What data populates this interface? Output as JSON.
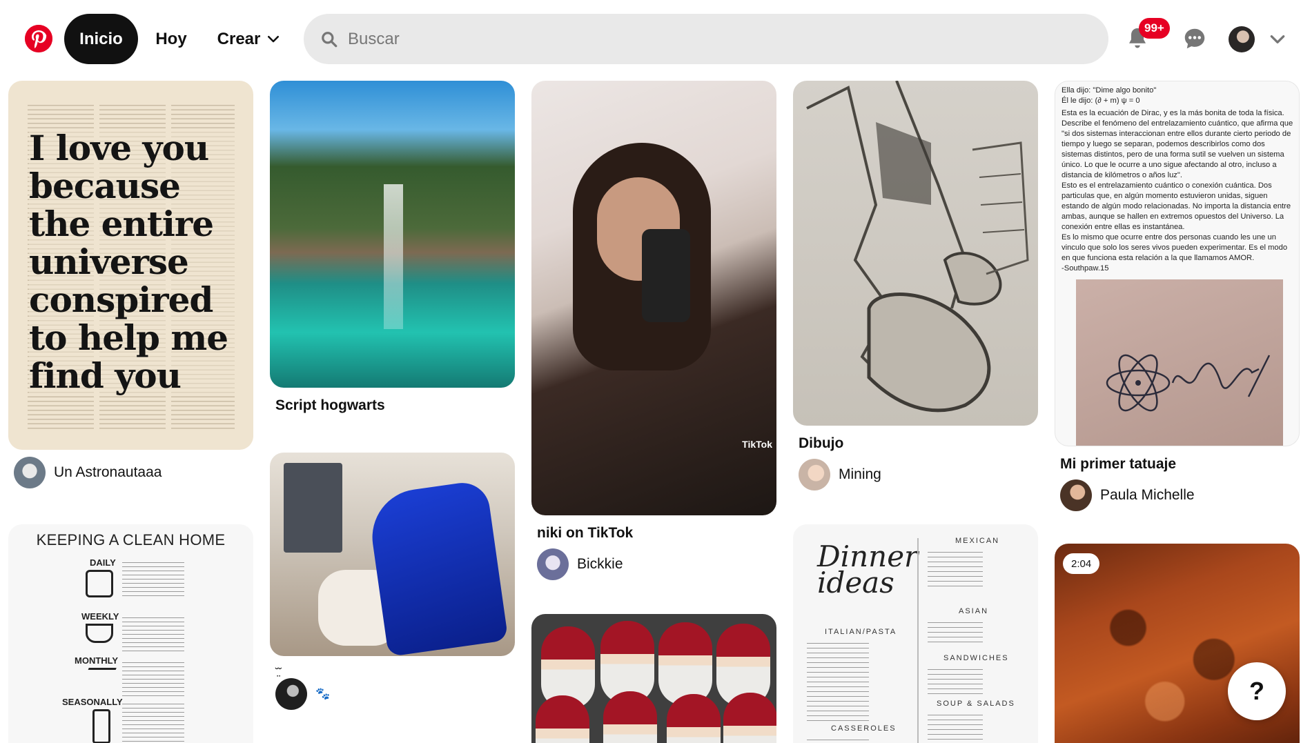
{
  "header": {
    "nav_home": "Inicio",
    "nav_today": "Hoy",
    "nav_create": "Crear",
    "search_placeholder": "Buscar",
    "notifications_badge": "99+"
  },
  "pins": {
    "quote": {
      "lines": [
        "I love you",
        "because",
        "the entire",
        "universe",
        "conspired",
        "to help me",
        "find you"
      ],
      "user": "Un Astronautaaa"
    },
    "lagoon": {
      "title": "Script hogwarts"
    },
    "blue": {
      "title": "˘̤˘",
      "user": "🐾"
    },
    "girl": {
      "title": "niki on TikTok",
      "user": "Bickkie",
      "watermark": "TikTok"
    },
    "sketch": {
      "title": "Dibujo",
      "user": "Mining"
    },
    "dirac": {
      "lines": [
        "Ella dijo: \"Dime algo bonito\"",
        "Él le dijo: (∂ + m) ψ = 0",
        "Esta es la ecuación de Dirac, y es la más bonita de toda la física. Describe el fenómeno del entrelazamiento cuántico, que afirma que \"si dos sistemas interaccionan entre ellos durante cierto periodo de tiempo y luego se separan, podemos describirlos como dos sistemas distintos, pero de una forma sutil se vuelven un sistema único. Lo que le ocurre a uno sigue afectando al otro, incluso a distancia de kilómetros o años luz\".",
        "Esto es el entrelazamiento cuántico o conexión cuántica. Dos particulas que, en algún momento estuvieron unidas, siguen estando de algún modo relacionadas. No importa la distancia entre ambas, aunque se hallen en extremos opuestos del Universo. La conexión entre ellas es instantánea.",
        "Es lo mismo que ocurre entre dos personas cuando les une un vinculo que solo los seres vivos pueden experimentar. Es el modo en que funciona esta relación a la que llamamos AMOR.",
        "-Southpaw.15"
      ],
      "title": "Mi primer tatuaje",
      "user": "Paula Michelle"
    },
    "clean": {
      "title": "KEEPING A CLEAN HOME",
      "rows": [
        "DAILY",
        "WEEKLY",
        "MONTHLY",
        "SEASONALLY"
      ]
    },
    "dinner": {
      "title": "Dinner ideas",
      "sections": [
        "MEXICAN",
        "ASIAN",
        "ITALIAN/PASTA",
        "SANDWICHES",
        "SOUP & SALADS",
        "CASSEROLES"
      ]
    },
    "salmon": {
      "duration": "2:04"
    }
  },
  "help_label": "?",
  "colors": {
    "brand": "#e60023",
    "nav_active_bg": "#111111",
    "search_bg": "#e9e9e9"
  }
}
